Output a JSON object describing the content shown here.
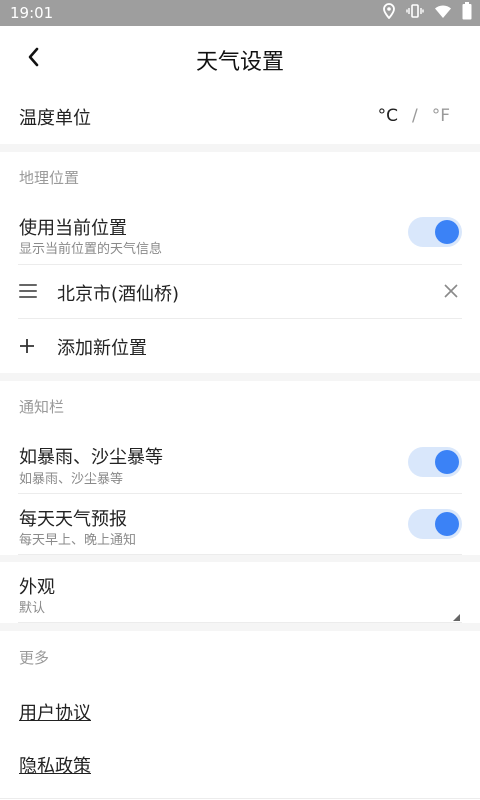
{
  "status_bar": {
    "time": "19:01",
    "icons": [
      "location-icon",
      "vibrate-icon",
      "wifi-icon",
      "battery-icon"
    ]
  },
  "header": {
    "title": "天气设置"
  },
  "temperature": {
    "label": "温度单位",
    "celsius": "°C",
    "separator": "/",
    "fahrenheit": "°F",
    "selected": "°C"
  },
  "location": {
    "section_title": "地理位置",
    "use_current": {
      "title": "使用当前位置",
      "subtitle": "显示当前位置的天气信息",
      "enabled": true
    },
    "saved_city": "北京市(酒仙桥)",
    "add_label": "添加新位置"
  },
  "notifications": {
    "section_title": "通知栏",
    "severe": {
      "title": "如暴雨、沙尘暴等",
      "subtitle": "如暴雨、沙尘暴等",
      "enabled": true
    },
    "daily": {
      "title": "每天天气预报",
      "subtitle": "每天早上、晚上通知",
      "enabled": true
    }
  },
  "appearance": {
    "title": "外观",
    "value": "默认"
  },
  "more": {
    "section_title": "更多",
    "user_agreement": "用户协议",
    "privacy_policy": "隐私政策"
  },
  "colors": {
    "accent": "#3b82f6",
    "toggle_track": "#d9e7fb",
    "status_bar": "#9e9e9e"
  }
}
